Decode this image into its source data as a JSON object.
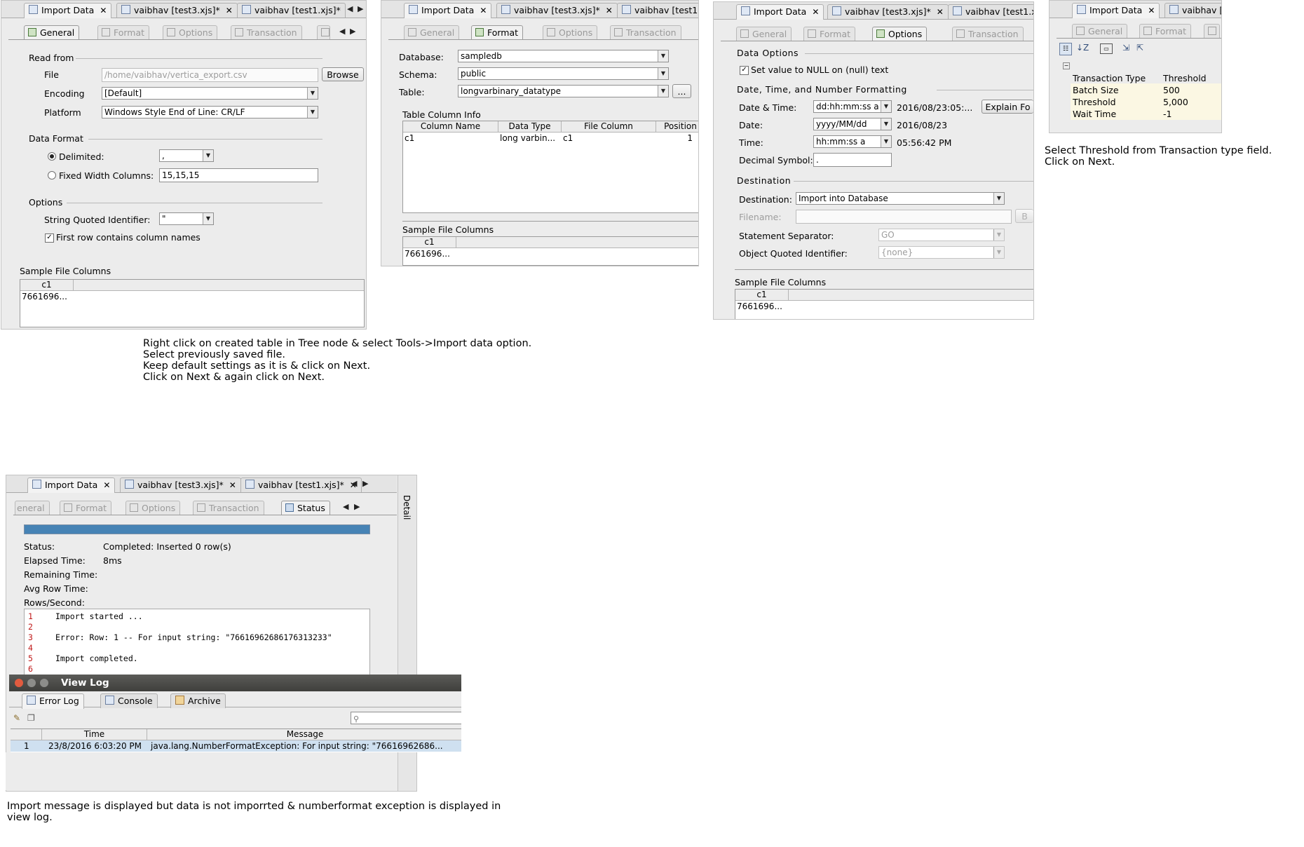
{
  "editor_tabs": {
    "import": "Import Data",
    "test3": "vaibhav [test3.xjs]*",
    "test1": "vaibhav [test1.xjs]*",
    "test1_cut": "vaibhav [test1.",
    "test1_cut2": "vaibhav [test1.x",
    "test3_cut": "vaibhav [t"
  },
  "subtabs": {
    "general": "General",
    "general_cut": "eneral",
    "format": "Format",
    "options": "Options",
    "transaction": "Transaction",
    "status": "Status"
  },
  "general": {
    "read_from": "Read from",
    "file_label": "File",
    "file_value": "/home/vaibhav/vertica_export.csv",
    "browse": "Browse",
    "encoding_label": "Encoding",
    "encoding_value": "[Default]",
    "platform_label": "Platform",
    "platform_value": "Windows Style End of Line: CR/LF",
    "data_format": "Data Format",
    "delimited": "Delimited:",
    "delimiter_value": ",",
    "fixed_width": "Fixed Width Columns:",
    "fixed_width_value": "15,15,15",
    "options": "Options",
    "string_quoted": "String Quoted Identifier:",
    "string_quoted_value": "\"",
    "first_row": "First row contains column names",
    "sample_file_columns": "Sample File Columns",
    "sample_header": "c1",
    "sample_value": "7661696..."
  },
  "format": {
    "database_label": "Database:",
    "database_value": "sampledb",
    "schema_label": "Schema:",
    "schema_value": "public",
    "table_label": "Table:",
    "table_value": "longvarbinary_datatype",
    "ellipsis": "...",
    "table_column_info": "Table Column Info",
    "columns": [
      "Column Name",
      "Data Type",
      "File Column",
      "Position"
    ],
    "row": [
      "c1",
      "long varbin...",
      "c1",
      "1"
    ],
    "sample_file_columns": "Sample File Columns",
    "sample_header": "c1",
    "sample_value": "7661696..."
  },
  "options": {
    "data_options": "Data Options",
    "null_text": "Set value to NULL on (null) text",
    "date_time_number": "Date, Time, and Number Formatting",
    "datetime_label": "Date & Time:",
    "datetime_value": "dd:hh:mm:ss a",
    "datetime_preview": "2016/08/23:05:...",
    "explain": "Explain Fo",
    "date_label": "Date:",
    "date_value": "yyyy/MM/dd",
    "date_preview": "2016/08/23",
    "time_label": "Time:",
    "time_value": "hh:mm:ss a",
    "time_preview": "05:56:42 PM",
    "decimal_label": "Decimal Symbol:",
    "decimal_value": ".",
    "destination_section": "Destination",
    "destination_label": "Destination:",
    "destination_value": "Import into Database",
    "filename_label": "Filename:",
    "filename_btn": "B",
    "statement_sep_label": "Statement Separator:",
    "statement_sep_value": "GO",
    "object_quoted_label": "Object Quoted Identifier:",
    "object_quoted_value": "{none}",
    "sample_file_columns": "Sample File Columns",
    "sample_header": "c1",
    "sample_value": "7661696..."
  },
  "transaction": {
    "rows": [
      {
        "key": "Transaction Type",
        "value": "Threshold"
      },
      {
        "key": "Batch Size",
        "value": "500"
      },
      {
        "key": "Threshold",
        "value": "5,000"
      },
      {
        "key": "Wait Time",
        "value": "-1"
      }
    ],
    "caption": [
      "Select Threshold from Transaction type field.",
      "Click on Next."
    ]
  },
  "caption_main": [
    "Right click on created table in Tree node & select Tools->Import data option.",
    "Select previously saved file.",
    "Keep default settings as it is & click on Next.",
    "Click on Next & again click on Next."
  ],
  "status": {
    "progress": 1.0,
    "status_label": "Status:",
    "status_value": "Completed: Inserted 0 row(s)",
    "elapsed_label": "Elapsed Time:",
    "elapsed_value": "8ms",
    "remaining_label": "Remaining Time:",
    "avg_label": "Avg Row Time:",
    "rows_label": "Rows/Second:",
    "detail": "Detail",
    "log_lines": [
      {
        "n": "1",
        "t": "Import started ..."
      },
      {
        "n": "2",
        "t": ""
      },
      {
        "n": "3",
        "t": "Error: Row: 1 -- For input string: \"76616962686176313233\""
      },
      {
        "n": "4",
        "t": ""
      },
      {
        "n": "5",
        "t": "Import completed."
      },
      {
        "n": "6",
        "t": ""
      }
    ]
  },
  "view_log": {
    "title": "View Log",
    "tabs": [
      "Error Log",
      "Console",
      "Archive"
    ],
    "search_placeholder": "",
    "columns": [
      "Time",
      "Message"
    ],
    "row": {
      "n": "1",
      "time": "23/8/2016 6:03:20 PM",
      "message": "java.lang.NumberFormatException: For input string: \"76616962686..."
    }
  },
  "caption_bottom": [
    "Import message is displayed but data is not imporrted & numberformat exception is displayed in",
    "view log."
  ],
  "colors": {
    "progress": "#4683b5",
    "selected_row": "#cfe0f0",
    "log_line_numbers": "#c01919",
    "titlebar": "#4a4a47"
  }
}
